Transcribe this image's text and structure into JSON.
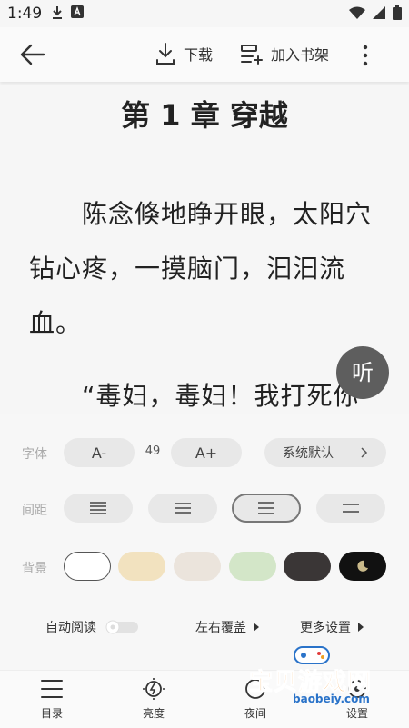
{
  "status": {
    "time": "1:49"
  },
  "toolbar": {
    "download_label": "下载",
    "bookshelf_label": "加入书架"
  },
  "reader": {
    "chapter_title": "第 1 章 穿越",
    "paragraphs": [
      "　　陈念倏地睁开眼，太阳穴钻心疼，一摸脑门，汩汩流血。",
      "　　“毒妇，毒妇！我打死你"
    ],
    "listen_label": "听"
  },
  "settings": {
    "font_label": "字体",
    "font_decrease": "A-",
    "font_size": "49",
    "font_increase": "A+",
    "font_family": "系统默认",
    "spacing_label": "间距",
    "background_label": "背景",
    "backgrounds": [
      "#ffffff",
      "#f2e2bf",
      "#ebe4dc",
      "#d3e6c8",
      "#3a3636",
      "#111111"
    ],
    "auto_read_label": "自动阅读",
    "page_turn_label": "左右覆盖",
    "more_settings_label": "更多设置"
  },
  "nav": {
    "toc_label": "目录",
    "brightness_label": "亮度",
    "night_label": "夜间",
    "settings_label": "设置"
  },
  "watermark": {
    "title": "宝贝游戏网",
    "url": "baobeiy.com"
  }
}
